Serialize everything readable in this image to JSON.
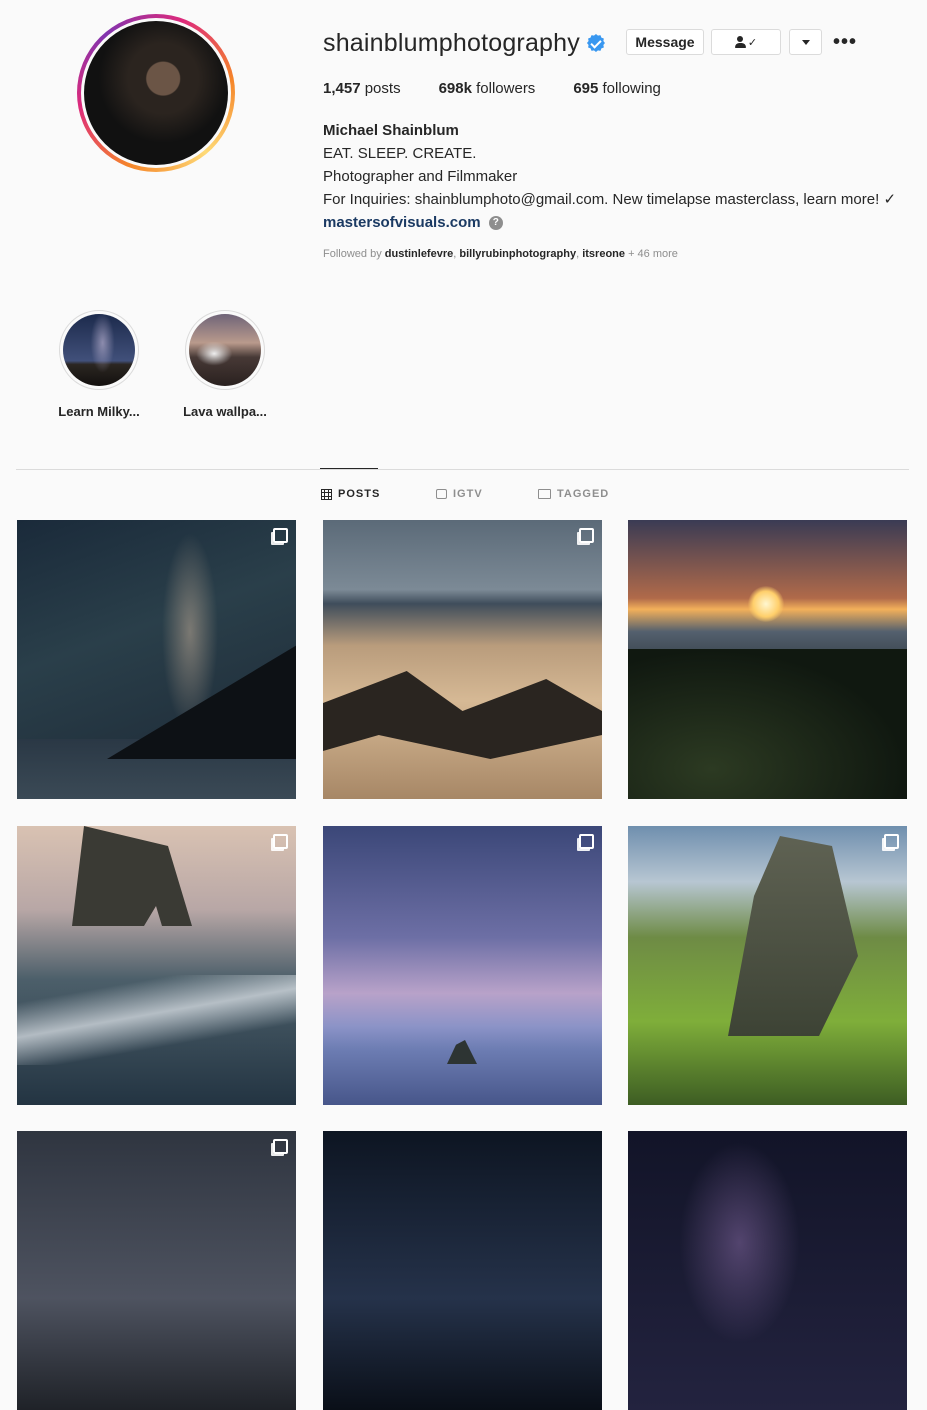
{
  "profile": {
    "username": "shainblumphotography",
    "verified": true,
    "buttons": {
      "message": "Message",
      "follow_icon": "person-check-icon",
      "dropdown_icon": "caret-down-icon",
      "more": "•••"
    },
    "stats": {
      "posts_count": "1,457",
      "posts_label": "posts",
      "followers_count": "698k",
      "followers_label": "followers",
      "following_count": "695",
      "following_label": "following"
    },
    "bio": {
      "name": "Michael Shainblum",
      "line1": "EAT. SLEEP. CREATE.",
      "line2": "Photographer and Filmmaker",
      "line3": "For Inquiries: shainblumphoto@gmail.com. New timelapse masterclass, learn more! ✓",
      "link": "mastersofvisuals.com"
    },
    "followed_by": {
      "prefix": "Followed by",
      "user1": "dustinlefevre",
      "user2": "billyrubinphotography",
      "user3": "itsreone",
      "more": "+ 46 more"
    }
  },
  "highlights": [
    {
      "label": "Learn Milky..."
    },
    {
      "label": "Lava wallpa..."
    }
  ],
  "tabs": [
    {
      "label": "POSTS",
      "icon": "grid-icon",
      "active": true
    },
    {
      "label": "IGTV",
      "icon": "tv-icon",
      "active": false
    },
    {
      "label": "TAGGED",
      "icon": "tag-icon",
      "active": false
    }
  ],
  "colors": {
    "accent": "#3897f0",
    "text": "#262626",
    "muted": "#8e8e8e",
    "background": "#fafafa"
  }
}
